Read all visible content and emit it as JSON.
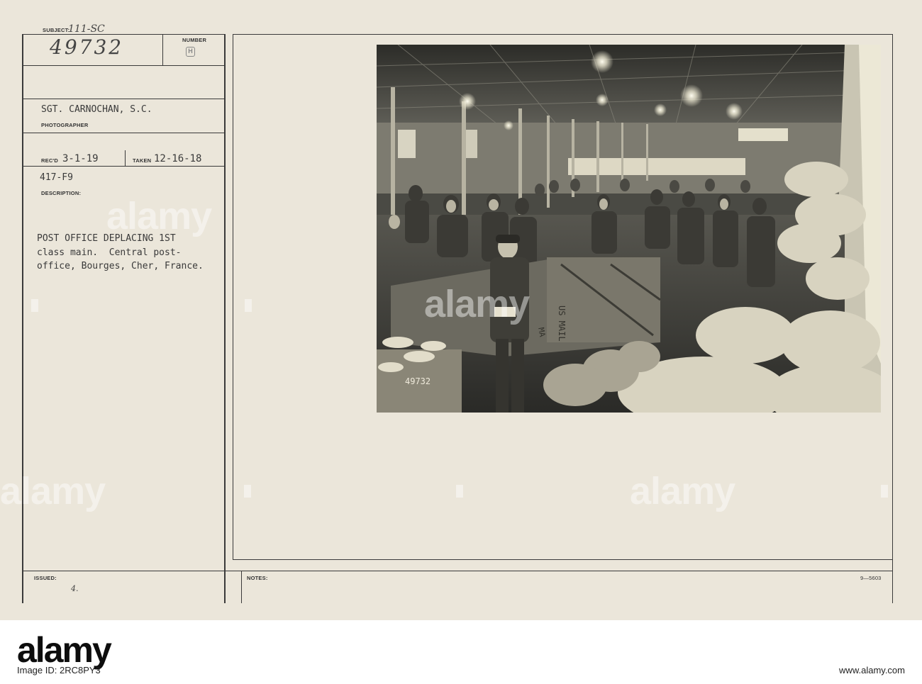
{
  "card": {
    "subject_label": "SUBJECT:",
    "subject_code": "111-SC",
    "subject_number": "49732",
    "number_label": "NUMBER",
    "number_stamp": "H",
    "photographer": "SGT. CARNOCHAN, S.C.",
    "photographer_label": "PHOTOGRAPHER",
    "recd_label": "REC'D",
    "recd_date": "3-1-19",
    "taken_label": "TAKEN",
    "taken_date": "12-16-18",
    "file_code": "417-F9",
    "description_label": "DESCRIPTION:",
    "description_line1": "POST OFFICE DEPLACING 1ST",
    "description_line2": "class main.  Central post-",
    "description_line3": "office, Bourges, Cher, France.",
    "issued_label": "ISSUED:",
    "issued_mark": "4.",
    "notes_label": "NOTES:",
    "form_number": "9—5603"
  },
  "photo": {
    "negative_number": "49732",
    "mailbag_text_1": "US MAIL",
    "mailbag_text_2": "MA"
  },
  "watermark": {
    "text": "alamy"
  },
  "footer": {
    "logo": "alamy",
    "image_id": "Image ID: 2RC8PY3",
    "site": "www.alamy.com"
  }
}
